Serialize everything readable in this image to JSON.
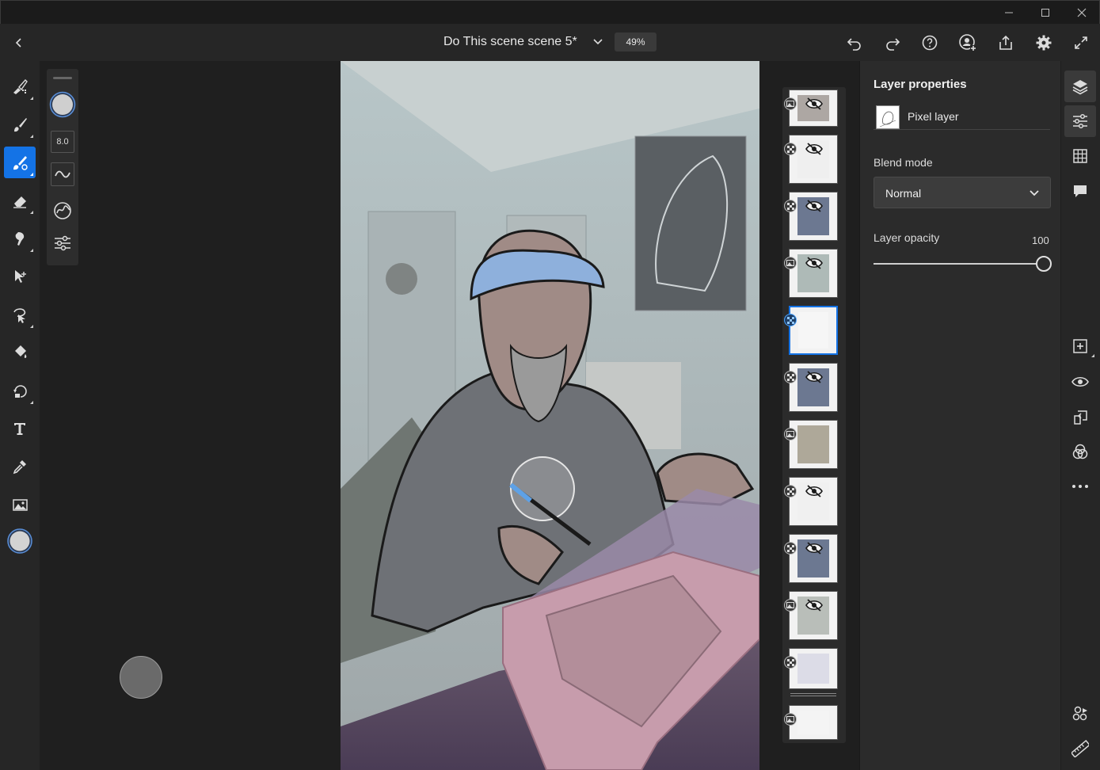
{
  "window": {
    "controls": [
      "minimize-icon",
      "maximize-icon",
      "close-icon"
    ]
  },
  "header": {
    "title": "Do This scene scene 5*",
    "zoom": "49%",
    "icons": [
      "undo-icon",
      "redo-icon",
      "help-icon",
      "invite-user-icon",
      "share-icon",
      "settings-icon",
      "fullscreen-icon"
    ]
  },
  "brush_panel": {
    "size_value": "8.0"
  },
  "tools": [
    "pixel-brush-icon",
    "live-brush-icon",
    "vector-brush-icon",
    "eraser-icon",
    "smudge-icon",
    "transform-icon",
    "selection-icon",
    "fill-icon",
    "shape-icon",
    "text-icon",
    "eyedropper-icon",
    "image-icon",
    "color-swatch"
  ],
  "layers": [
    {
      "type": "image",
      "hidden": true
    },
    {
      "type": "pixel",
      "hidden": true
    },
    {
      "type": "pixel",
      "hidden": true
    },
    {
      "type": "image",
      "hidden": true
    },
    {
      "type": "pixel",
      "hidden": false,
      "selected": true
    },
    {
      "type": "pixel",
      "hidden": true
    },
    {
      "type": "image",
      "hidden": false
    },
    {
      "type": "pixel",
      "hidden": true
    },
    {
      "type": "pixel",
      "hidden": true
    },
    {
      "type": "image",
      "hidden": true
    },
    {
      "type": "pixel",
      "hidden": false
    },
    {
      "type": "image",
      "hidden": false
    }
  ],
  "properties": {
    "title": "Layer properties",
    "layer_type": "Pixel layer",
    "blend_label": "Blend mode",
    "blend_value": "Normal",
    "opacity_label": "Layer opacity",
    "opacity_value": "100",
    "opacity_level": 100
  },
  "colors": {
    "accent": "#1473e6",
    "panel": "#2b2b2b",
    "bg": "#1f1f1f"
  }
}
